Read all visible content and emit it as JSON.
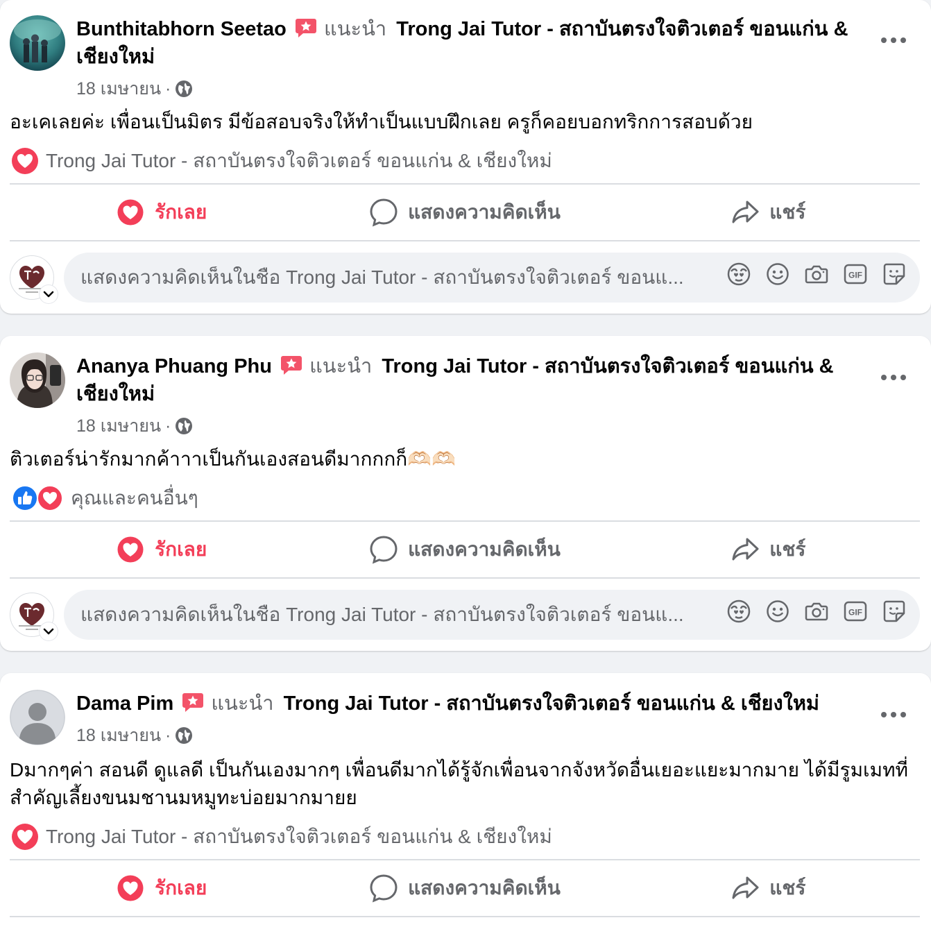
{
  "colors": {
    "love_red": "#f33e58",
    "like_blue": "#1877f2",
    "secondary_text": "#65676b",
    "divider": "#dadde1",
    "recommend_badge": "#f35369"
  },
  "posts": [
    {
      "author": "Bunthitabhorn Seetao",
      "recommend_word": "แนะนำ",
      "page_name": "Trong Jai Tutor - สถาบันตรงใจติวเตอร์ ขอนแก่น & เชียงใหม่",
      "date": "18 เมษายน",
      "meta_sep": "·",
      "body": "อะเคเลยค่ะ เพื่อนเป็นมิตร มีข้อสอบจริงให้ทำเป็นแบบฝึกเลย ครูก็คอยบอกทริกการสอบด้วย",
      "reaction_label": "Trong Jai Tutor - สถาบันตรงใจติวเตอร์ ขอนแก่น & เชียงใหม่",
      "reaction_icons": [
        "love-icon"
      ],
      "actions": {
        "love": "รักเลย",
        "comment": "แสดงความคิดเห็น",
        "share": "แชร์"
      },
      "comment_placeholder": "แสดงความคิดเห็นในชื่อ Trong Jai Tutor - สถาบันตรงใจติวเตอร์ ขอนแ..."
    },
    {
      "author": "Ananya Phuang Phu",
      "recommend_word": "แนะนำ",
      "page_name": "Trong Jai Tutor - สถาบันตรงใจติวเตอร์ ขอนแก่น & เชียงใหม่",
      "date": "18 เมษายน",
      "meta_sep": "·",
      "body": "ติวเตอร์น่ารักมากค้าาาเป็นกันเองสอนดีมากกกก็🫶🏻🫶🏻",
      "reaction_label": "คุณและคนอื่นๆ",
      "reaction_icons": [
        "like-icon",
        "love-icon"
      ],
      "actions": {
        "love": "รักเลย",
        "comment": "แสดงความคิดเห็น",
        "share": "แชร์"
      },
      "comment_placeholder": "แสดงความคิดเห็นในชื่อ Trong Jai Tutor - สถาบันตรงใจติวเตอร์ ขอนแ..."
    },
    {
      "author": "Dama Pim",
      "recommend_word": "แนะนำ",
      "page_name": "Trong Jai Tutor - สถาบันตรงใจติวเตอร์ ขอนแก่น & เชียงใหม่",
      "date": "18 เมษายน",
      "meta_sep": "·",
      "body": "Dมากๆค่า สอนดี ดูแลดี เป็นกันเองมากๆ เพื่อนดีมากได้รู้จักเพื่อนจากจังหวัดอื่นเยอะแยะมากมาย ได้มีรูมเมทที่สำคัญเลี้ยงขนมชานมหมูทะบ่อยมากมายย",
      "reaction_label": "Trong Jai Tutor - สถาบันตรงใจติวเตอร์ ขอนแก่น & เชียงใหม่",
      "reaction_icons": [
        "love-icon"
      ],
      "actions": {
        "love": "รักเลย",
        "comment": "แสดงความคิดเห็น",
        "share": "แชร์"
      }
    }
  ]
}
